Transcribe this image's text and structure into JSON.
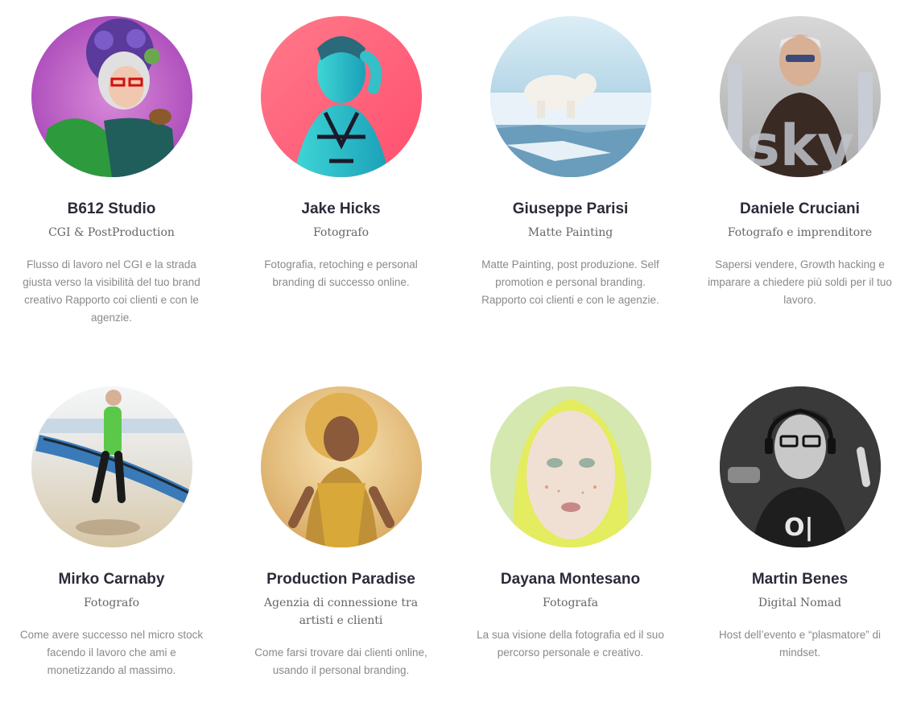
{
  "speakers": [
    {
      "name": "B612 Studio",
      "role": "CGI & PostProduction",
      "description": "Flusso di lavoro nel CGI e la strada giusta verso la visibilità del tuo brand creativo Rapporto coi clienti e con le agenzie."
    },
    {
      "name": "Jake Hicks",
      "role": "Fotografo",
      "description": "Fotografia, retoching e personal branding di successo online."
    },
    {
      "name": "Giuseppe Parisi",
      "role": "Matte Painting",
      "description": "Matte Painting, post produzione. Self promotion e personal branding. Rapporto coi clienti e con le agenzie."
    },
    {
      "name": "Daniele Cruciani",
      "role": "Fotografo e imprenditore",
      "description": "Sapersi vendere, Growth hacking e imparare a chiedere più soldi per il tuo lavoro."
    },
    {
      "name": "Mirko Carnaby",
      "role": "Fotografo",
      "description": "Come avere successo nel micro stock facendo il lavoro che ami e monetizzando al massimo."
    },
    {
      "name": "Production Paradise",
      "role": "Agenzia di connessione tra artisti e clienti",
      "description": "Come farsi trovare dai clienti online, usando il personal branding."
    },
    {
      "name": "Dayana Montesano",
      "role": "Fotografa",
      "description": "La sua visione della fotografia ed il suo percorso personale e creativo."
    },
    {
      "name": "Martin Benes",
      "role": "Digital Nomad",
      "description": "Host dell’evento e “plasmatore” di mindset."
    }
  ],
  "colors": {
    "name_text": "#2b2b3a",
    "role_text": "#666666",
    "desc_text": "#8a8a8a",
    "background": "#ffffff"
  }
}
